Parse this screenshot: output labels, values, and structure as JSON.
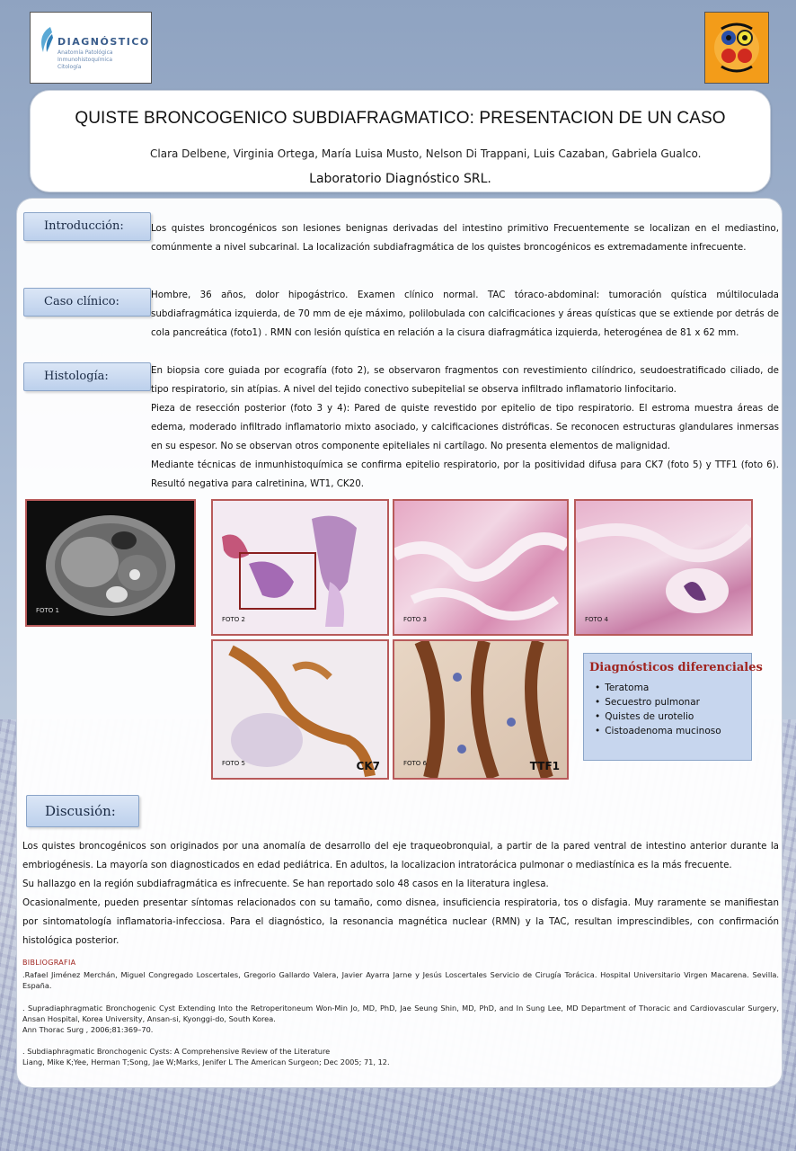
{
  "logo": {
    "name": "DIAGNÓSTICO",
    "sub": [
      "Anatomía Patológica",
      "Inmunohistoquímica",
      "Citología"
    ]
  },
  "header": {
    "title": "QUISTE BRONCOGENICO SUBDIAFRAGMATICO: PRESENTACION DE UN CASO",
    "authors": "Clara Delbene, Virginia Ortega,  María Luisa Musto,  Nelson Di Trappani,  Luis Cazaban,  Gabriela Gualco.",
    "lab": "Laboratorio Diagnóstico SRL."
  },
  "sections": {
    "intro": {
      "label": "Introducción:",
      "text": "Los quistes broncogénicos son lesiones benignas derivadas del intestino primitivo  Frecuentemente se localizan en el mediastino, comúnmente a nivel subcarinal. La localización subdiafragmática de los quistes broncogénicos es  extremadamente infrecuente."
    },
    "case": {
      "label": "Caso clínico:",
      "text": "Hombre, 36 años, dolor hipogástrico. Examen clínico normal. TAC tóraco-abdominal: tumoración quística múltiloculada subdiafragmática izquierda, de 70 mm de eje máximo, polilobulada con calcificaciones y áreas quísticas que se extiende por detrás de cola pancreática (foto1) . RMN con lesión quística en relación a la cisura diafragmática izquierda, heterogénea de 81 x 62 mm."
    },
    "histo": {
      "label": "Histología:",
      "p1": "En biopsia core guiada por ecografía (foto 2), se observaron fragmentos con revestimiento cilíndrico, seudoestratificado ciliado, de tipo respiratorio, sin atípias. A nivel del tejido conectivo subepitelial se observa infiltrado inflamatorio linfocitario.",
      "p2": "Pieza de resección posterior (foto 3 y 4): Pared de quiste revestido por epitelio de tipo respiratorio. El estroma muestra áreas de edema, moderado infiltrado inflamatorio mixto asociado, y calcificaciones distróficas. Se reconocen estructuras glandulares inmersas en su espesor. No se observan otros componente epiteliales ni cartílago. No presenta elementos de malignidad.",
      "p3": "Mediante técnicas de inmunhistoquímica se confirma epitelio respiratorio, por la positividad difusa para CK7 (foto 5) y TTF1 (foto 6). Resultó negativa para calretinina, WT1, CK20."
    },
    "discussion": {
      "label": "Discusión:",
      "p1": "Los quistes broncogénicos son originados por una anomalía de desarrollo del eje traqueobronquial, a partir de la pared ventral de intestino anterior durante la embriogénesis. La mayoría son diagnosticados en edad pediátrica. En adultos, la localizacion intratorácica pulmonar o mediastínica es la más frecuente.",
      "p2": "Su hallazgo  en la región subdiafragmática es infrecuente. Se han reportado solo 48 casos en la literatura inglesa.",
      "p3": "Ocasionalmente, pueden presentar síntomas relacionados con su tamaño,  como disnea, insuficiencia respiratoria, tos o disfagia.  Muy raramente se manifiestan por sintomatología inflamatoria-infecciosa.  Para el diagnóstico, la resonancia magnética nuclear (RMN) y la TAC, resultan imprescindibles, con confirmación histológica posterior."
    }
  },
  "photos": {
    "f1": "FOTO 1",
    "f2": "FOTO 2",
    "f3": "FOTO 3",
    "f4": "FOTO 4",
    "f5": "FOTO 5",
    "f6": "FOTO 6",
    "stain5": "CK7",
    "stain6": "TTF1"
  },
  "ddx": {
    "title": "Diagnósticos diferenciales",
    "items": [
      "Teratoma",
      "Secuestro pulmonar",
      "Quistes de urotelio",
      "Cistoadenoma mucinoso"
    ]
  },
  "biblio": {
    "heading": "BIBLIOGRAFIA",
    "r1": ".Rafael Jiménez Merchán, Miguel Congregado Loscertales, Gregorio Gallardo Valera, Javier Ayarra Jarne y Jesús Loscertales Servicio de Cirugía Torácica. Hospital Universitario Virgen Macarena. Sevilla. España.",
    "r2a": ". Supradiaphragmatic Bronchogenic Cyst Extending Into the Retroperitoneum Won-Min Jo, MD, PhD, Jae Seung Shin, MD, PhD, and In Sung Lee, MD Department of Thoracic and Cardiovascular Surgery, Ansan Hospital, Korea University, Ansan-si, Kyonggi-do, South Korea.",
    "r2b": "Ann Thorac Surg , 2006;81:369–70.",
    "r3a": ". Subdiaphragmatic Bronchogenic Cysts: A Comprehensive Review of the Literature",
    "r3b": "Liang, Mike K;Yee, Herman T;Song, Jae W;Marks, Jenifer L The American Surgeon; Dec 2005; 71, 12."
  },
  "colors": {
    "accent_red": "#a0241f",
    "label_blue": "#bcd0ec",
    "emblem_orange": "#f39c19"
  }
}
